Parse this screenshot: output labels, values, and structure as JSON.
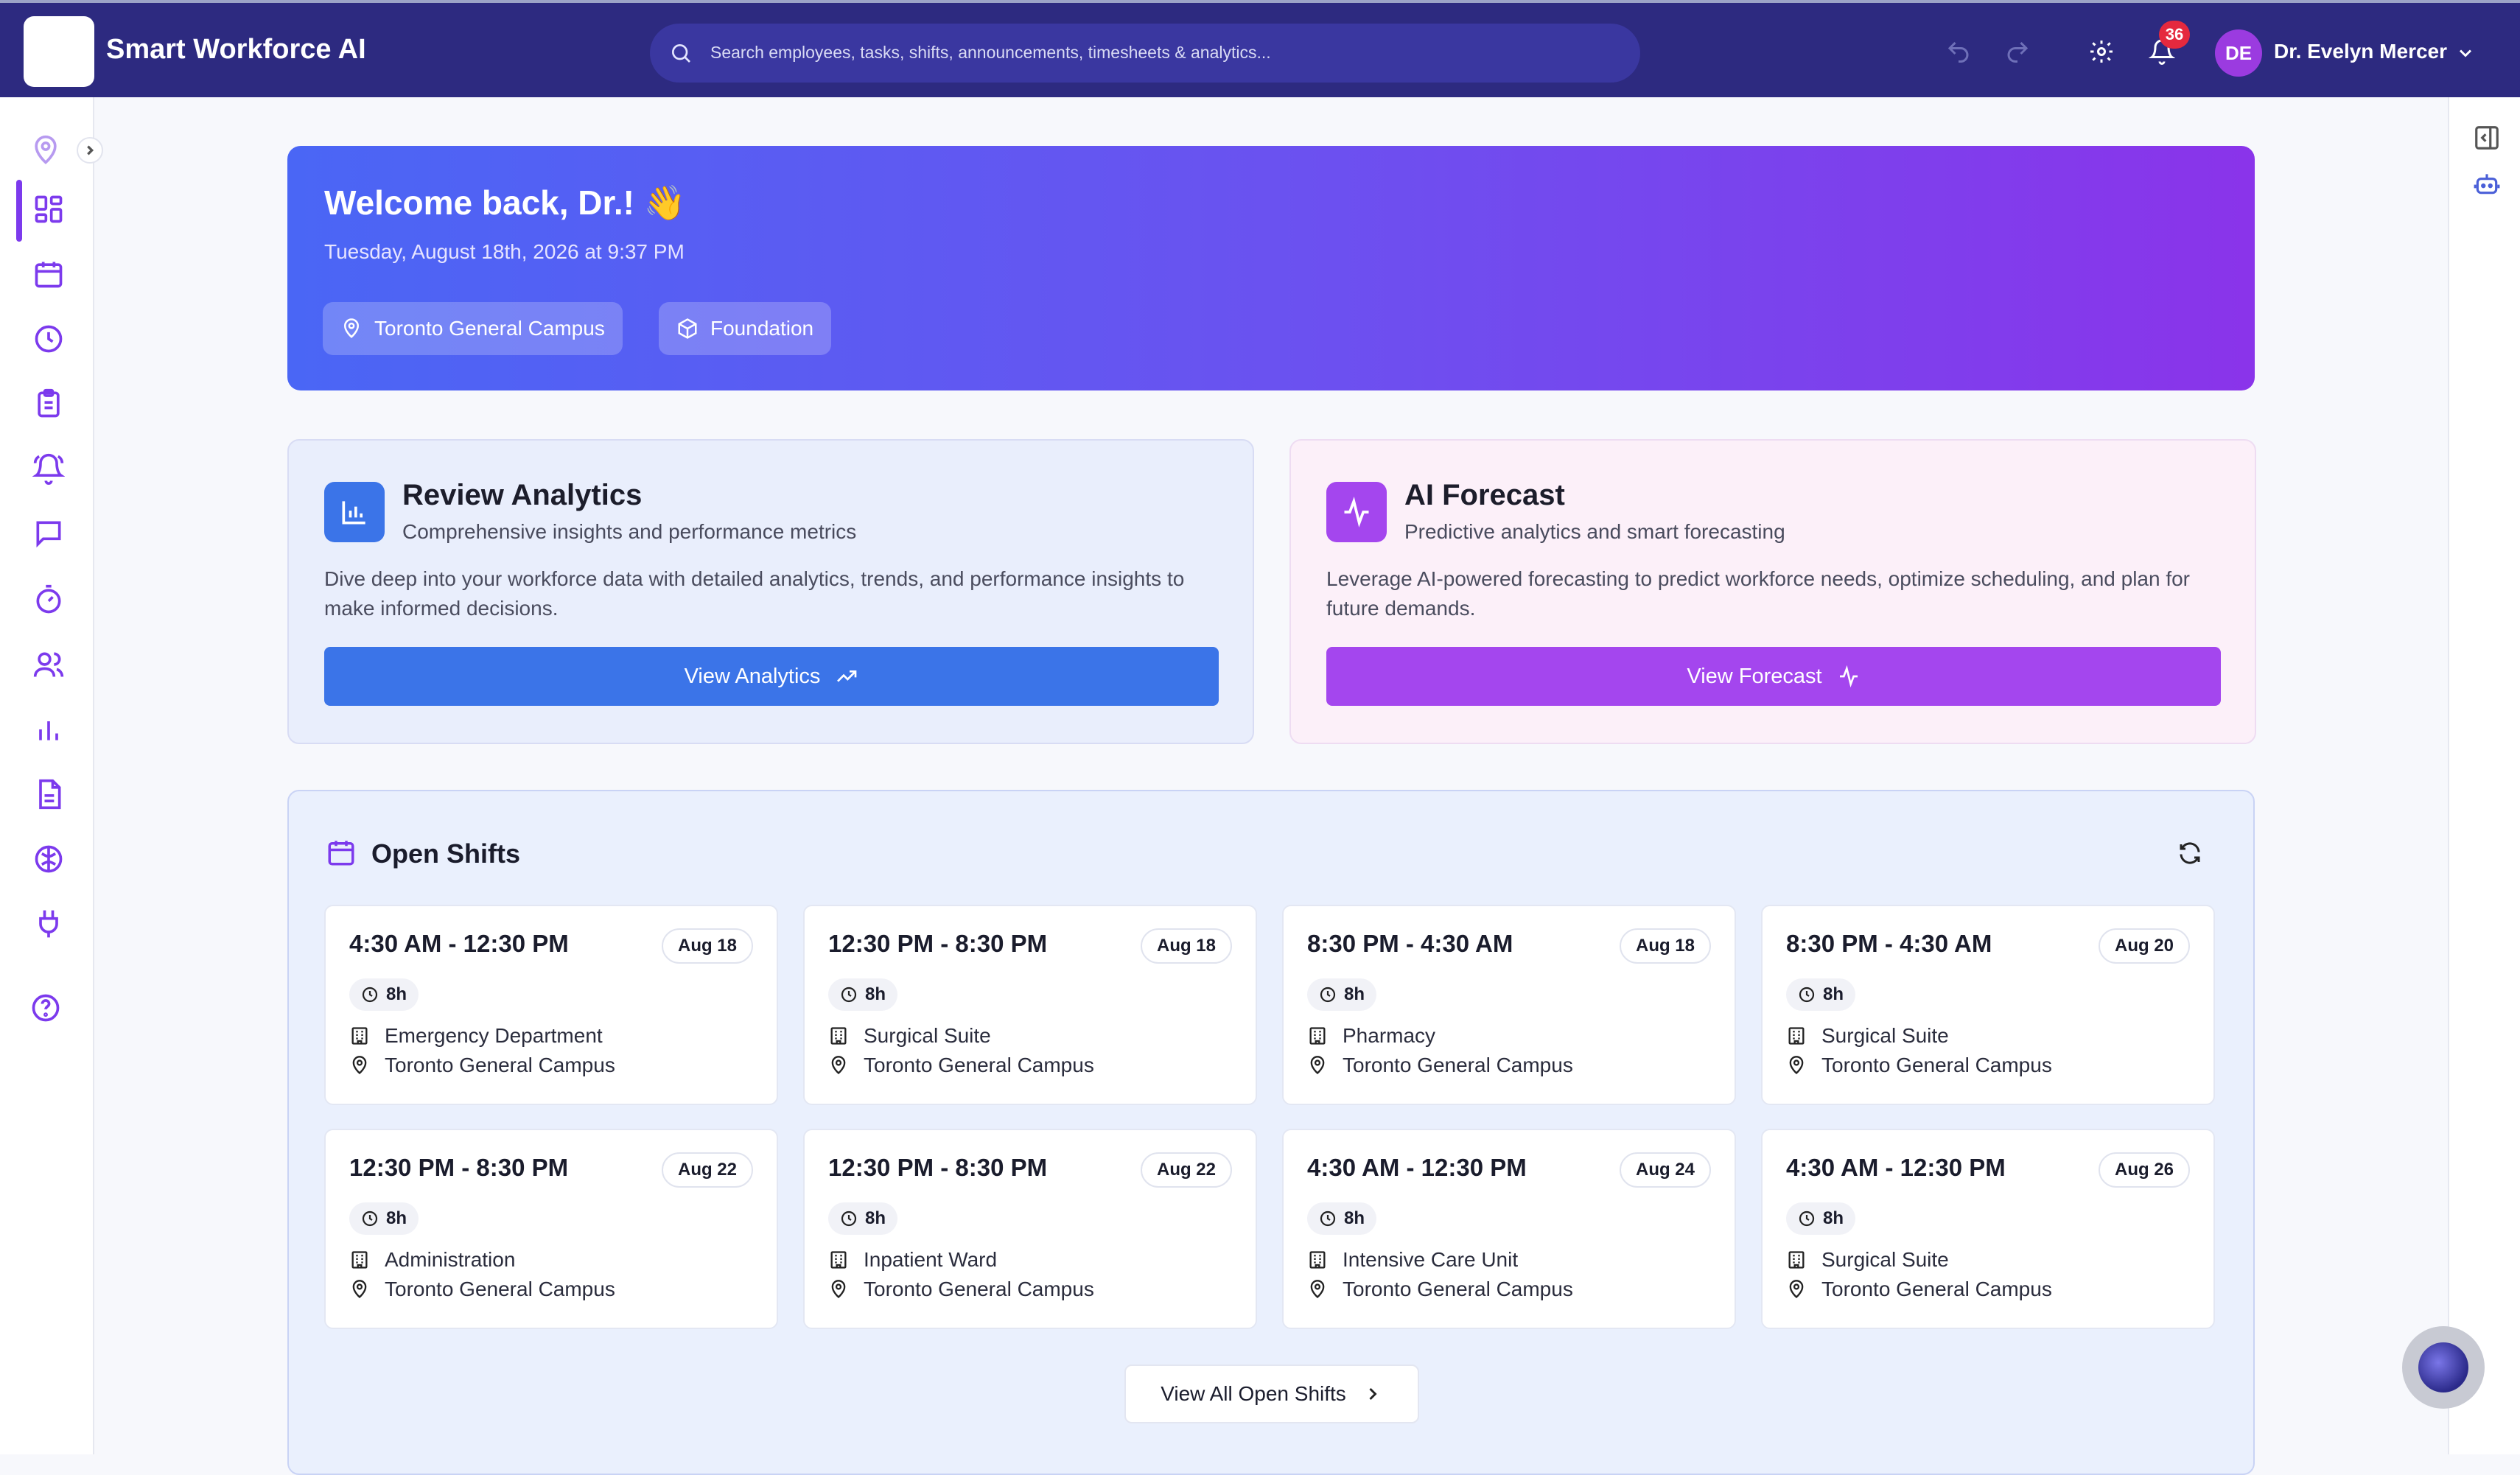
{
  "header": {
    "app_title": "Smart Workforce AI",
    "search_placeholder": "Search employees, tasks, shifts, announcements, timesheets & analytics...",
    "notification_count": "36",
    "user_initials": "DE",
    "user_name": "Dr. Evelyn Mercer"
  },
  "sidebar": {
    "items": [
      "location-pin-icon",
      "dashboard-icon",
      "calendar-icon",
      "clock-icon",
      "clipboard-icon",
      "bell-icon",
      "chat-icon",
      "timer-icon",
      "users-icon",
      "bar-chart-icon",
      "document-icon",
      "brain-icon",
      "plug-icon",
      "help-icon"
    ],
    "active": "dashboard-icon"
  },
  "hero": {
    "title": "Welcome back, Dr.! 👋",
    "date": "Tuesday, August 18th, 2026 at 9:37 PM",
    "location_chip": "Toronto General Campus",
    "plan_chip": "Foundation"
  },
  "analytics_card": {
    "title": "Review Analytics",
    "subtitle": "Comprehensive insights and performance metrics",
    "description": "Dive deep into your workforce data with detailed analytics, trends, and performance insights to make informed decisions.",
    "button": "View Analytics",
    "accent": "#3b74e8"
  },
  "forecast_card": {
    "title": "AI Forecast",
    "subtitle": "Predictive analytics and smart forecasting",
    "description": "Leverage AI-powered forecasting to predict workforce needs, optimize scheduling, and plan for future demands.",
    "button": "View Forecast",
    "accent": "#a446ee"
  },
  "open_shifts": {
    "title": "Open Shifts",
    "view_all": "View All Open Shifts",
    "shifts": [
      {
        "time": "4:30 AM - 12:30 PM",
        "date": "Aug 18",
        "duration": "8h",
        "department": "Emergency Department",
        "location": "Toronto General Campus"
      },
      {
        "time": "12:30 PM - 8:30 PM",
        "date": "Aug 18",
        "duration": "8h",
        "department": "Surgical Suite",
        "location": "Toronto General Campus"
      },
      {
        "time": "8:30 PM - 4:30 AM",
        "date": "Aug 18",
        "duration": "8h",
        "department": "Pharmacy",
        "location": "Toronto General Campus"
      },
      {
        "time": "8:30 PM - 4:30 AM",
        "date": "Aug 20",
        "duration": "8h",
        "department": "Surgical Suite",
        "location": "Toronto General Campus"
      },
      {
        "time": "12:30 PM - 8:30 PM",
        "date": "Aug 22",
        "duration": "8h",
        "department": "Administration",
        "location": "Toronto General Campus"
      },
      {
        "time": "12:30 PM - 8:30 PM",
        "date": "Aug 22",
        "duration": "8h",
        "department": "Inpatient Ward",
        "location": "Toronto General Campus"
      },
      {
        "time": "4:30 AM - 12:30 PM",
        "date": "Aug 24",
        "duration": "8h",
        "department": "Intensive Care Unit",
        "location": "Toronto General Campus"
      },
      {
        "time": "4:30 AM - 12:30 PM",
        "date": "Aug 26",
        "duration": "8h",
        "department": "Surgical Suite",
        "location": "Toronto General Campus"
      }
    ]
  }
}
